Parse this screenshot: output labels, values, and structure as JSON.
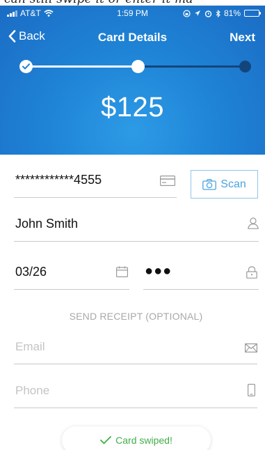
{
  "top_text": "can still swipe it or enter it ma",
  "status_bar": {
    "carrier": "AT&T",
    "time": "1:59 PM",
    "battery": "81%",
    "battery_level": 0.81
  },
  "navbar": {
    "back_label": "Back",
    "title": "Card Details",
    "next_label": "Next"
  },
  "progress": {
    "steps_total": 3,
    "current_step": 2
  },
  "amount": "$125",
  "card": {
    "number": "************4555",
    "scan_label": "Scan"
  },
  "name": "John Smith",
  "expiry": "03/26",
  "cvv": "●●●",
  "receipt": {
    "section_label": "SEND RECEIPT (OPTIONAL)",
    "email_placeholder": "Email",
    "phone_placeholder": "Phone"
  },
  "toast": {
    "message": "Card swiped!"
  },
  "colors": {
    "header_blue": "#1f84d6",
    "progress_inactive": "#13457d",
    "accent": "#4aa3e0",
    "success": "#3fae4a"
  }
}
